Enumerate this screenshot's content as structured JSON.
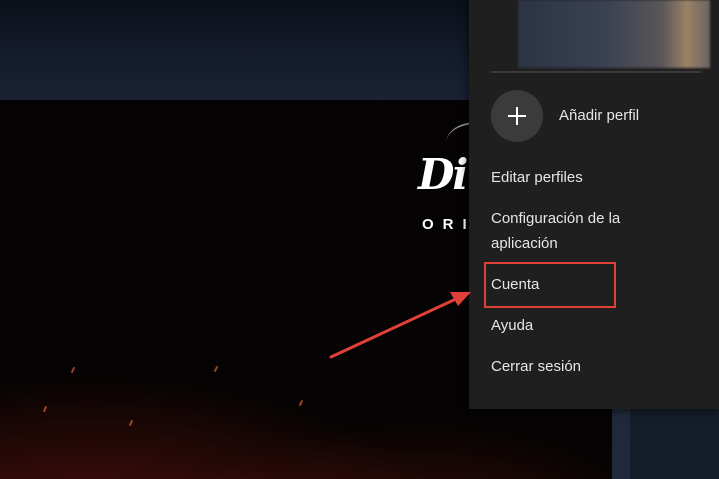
{
  "logo": {
    "brand_script": "Di",
    "subtitle": "ORI"
  },
  "menu": {
    "add_profile_label": "Añadir perfil",
    "items": [
      {
        "label": "Editar perfiles"
      },
      {
        "label": "Configuración de la aplicación"
      },
      {
        "label": "Cuenta"
      },
      {
        "label": "Ayuda"
      },
      {
        "label": "Cerrar sesión"
      }
    ],
    "highlighted_item": "Cuenta"
  },
  "icons": {
    "add": "plus-icon"
  },
  "colors": {
    "menu_background": "#1f1f1f",
    "menu_text": "#e6e6e6",
    "annotation_red": "#e0403a",
    "add_button_background": "#3b3b3b"
  }
}
